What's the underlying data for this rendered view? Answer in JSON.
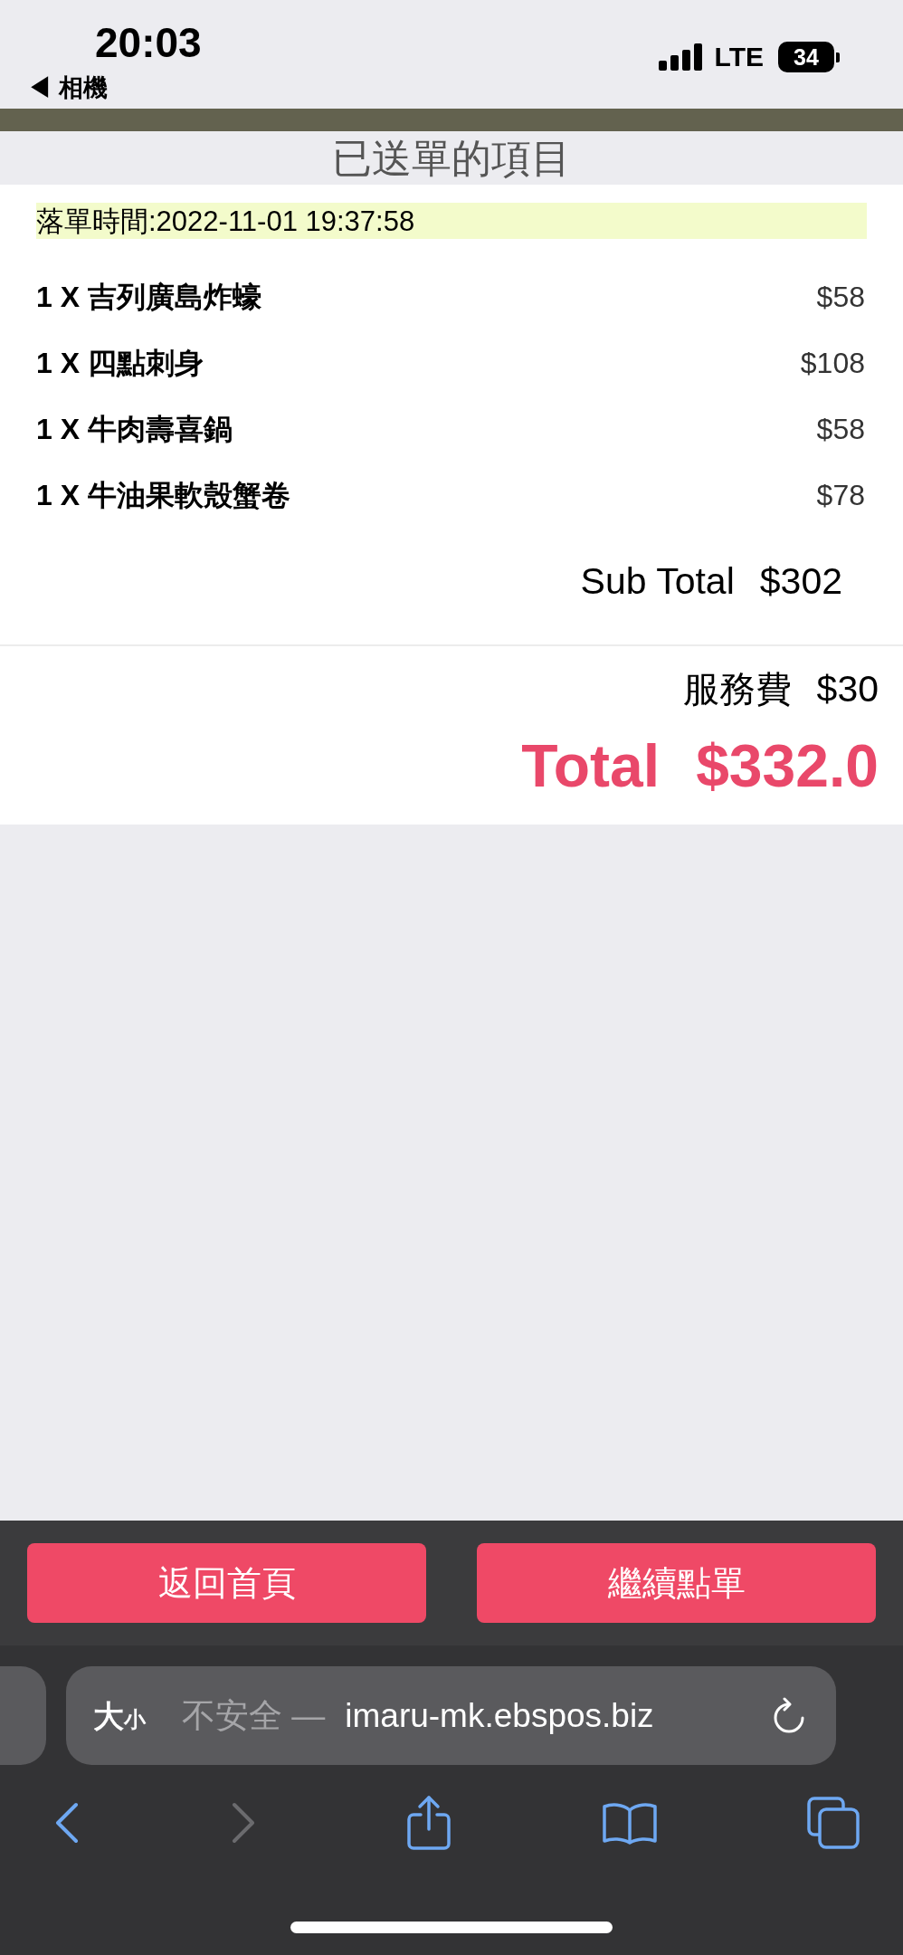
{
  "status_bar": {
    "time": "20:03",
    "back_link": "◀ 相機",
    "network": "LTE",
    "battery": "34"
  },
  "header": {
    "title": "已送單的項目"
  },
  "order": {
    "time": "落單時間:2022-11-01 19:37:58",
    "items": [
      {
        "name": "1 X 吉列廣島炸蠔",
        "price": "$58"
      },
      {
        "name": "1 X 四點刺身",
        "price": "$108"
      },
      {
        "name": "1 X 牛肉壽喜鍋",
        "price": "$58"
      },
      {
        "name": "1 X 牛油果軟殼蟹卷",
        "price": "$78"
      }
    ],
    "subtotal": {
      "label": "Sub Total",
      "amount": "$302"
    },
    "service_charge": {
      "label": "服務費",
      "amount": "$30"
    },
    "total": {
      "label": "Total",
      "amount": "$332.0"
    }
  },
  "buttons": [
    {
      "label": "返回首頁"
    },
    {
      "label": "繼續點單"
    }
  ],
  "browser": {
    "text_size": {
      "large": "大",
      "small": "小"
    },
    "security": "不安全 —",
    "host": "imaru-mk.ebspos.biz",
    "toolbar": [
      {
        "kind": "back",
        "disabled": false
      },
      {
        "kind": "forward",
        "disabled": true
      },
      {
        "kind": "share",
        "disabled": false
      },
      {
        "kind": "bookmarks",
        "disabled": false
      },
      {
        "kind": "tabs",
        "disabled": false
      }
    ]
  }
}
